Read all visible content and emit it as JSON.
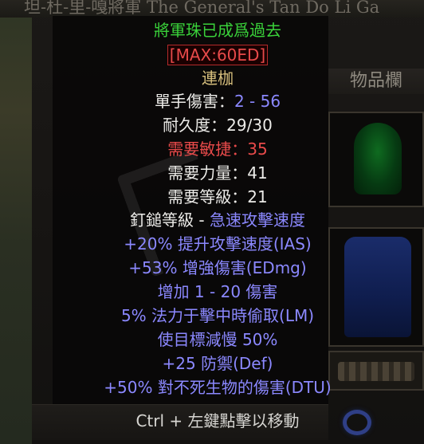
{
  "background": {
    "title_text": "坦-杜-里-嘎將軍 The General's Tan Do Li Ga",
    "inventory_label": "物品欄"
  },
  "tooltip": {
    "quest_note": "將軍珠已成爲過去",
    "max_tag": "[MAX:60ED]",
    "item_type": "連枷",
    "damage_label": "單手傷害：",
    "damage_value": "2 - 56",
    "durability": "耐久度：29/30",
    "req_dex_label": "需要敏捷：",
    "req_dex_value": "35",
    "req_str": "需要力量：41",
    "req_level": "需要等級：21",
    "socket_label": "釘鎚等級 - ",
    "socket_value": "急速攻擊速度",
    "mods": [
      "+20% 提升攻擊速度(IAS)",
      "+53% 增強傷害(EDmg)",
      "增加 1 - 20 傷害",
      "5% 法力于擊中時偷取(LM)",
      "使目標減慢 50%",
      "+25 防禦(Def)",
      "+50% 對不死生物的傷害(DTU)"
    ],
    "hint": "Ctrl + 左鍵點擊以移動"
  },
  "colors": {
    "unique_gold": "#d6be7c",
    "magic_blue": "#8b88ff",
    "requirement_red": "#e84a4a",
    "quest_green": "#3ad23a"
  }
}
